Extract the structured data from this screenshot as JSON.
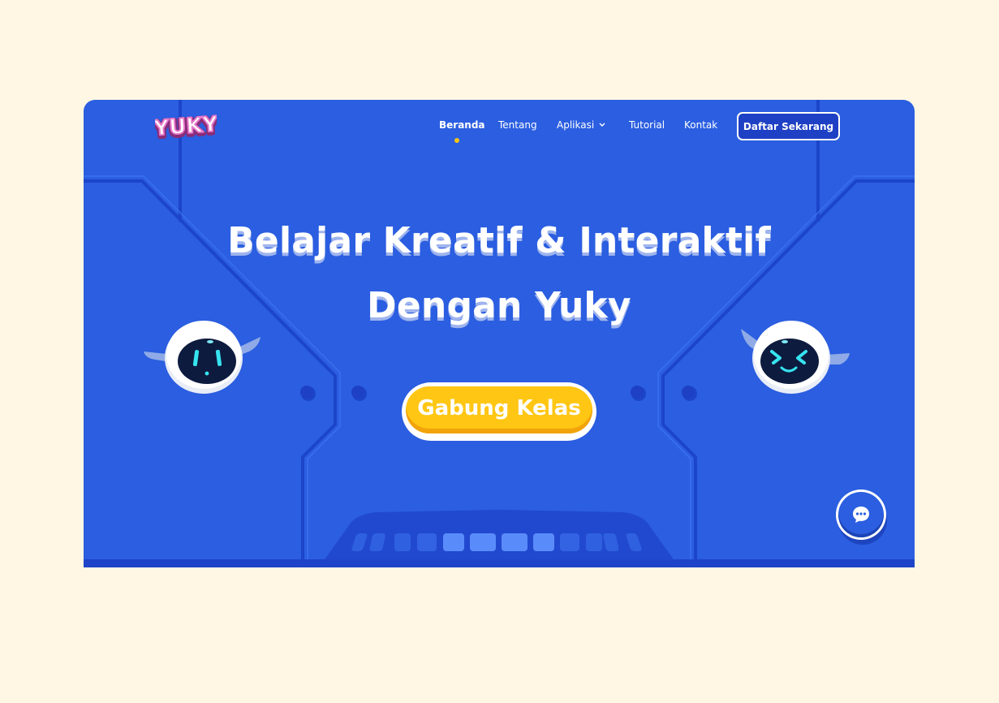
{
  "brand": {
    "logo_text": "YUKY"
  },
  "nav": {
    "items": [
      {
        "label": "Beranda",
        "active": true
      },
      {
        "label": "Tentang"
      },
      {
        "label": "Aplikasi",
        "has_dropdown": true
      },
      {
        "label": "Tutorial"
      },
      {
        "label": "Kontak"
      }
    ],
    "cta_label": "Daftar Sekarang"
  },
  "hero": {
    "title_line1": "Belajar Kreatif & Interaktif",
    "title_line2": "Dengan Yuky",
    "button_label": "Gabung Kelas"
  },
  "icons": {
    "chat": "chat-bubble-icon",
    "dropdown": "chevron-down-icon"
  },
  "colors": {
    "page_bg": "#FFF7E4",
    "hero_bg": "#2B5EE0",
    "accent_yellow": "#FFC614",
    "cta_dark": "#1E40C4",
    "robot_screen": "#0D1B3E",
    "robot_eye": "#36E4F0"
  }
}
